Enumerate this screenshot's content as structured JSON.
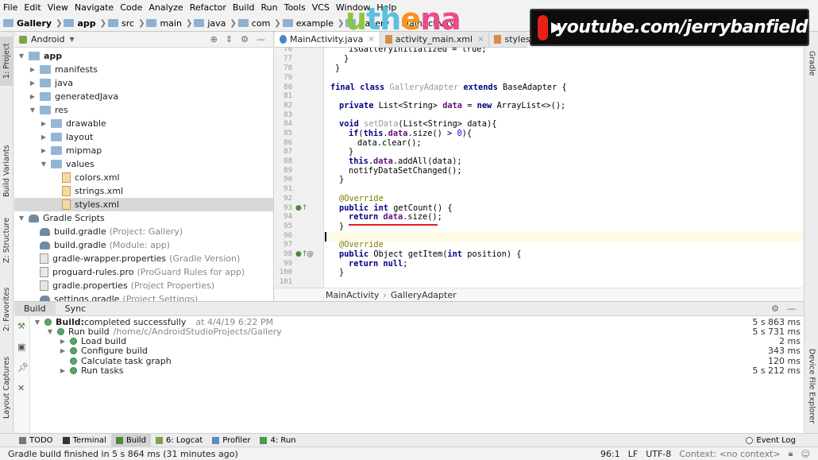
{
  "menu": [
    "File",
    "Edit",
    "View",
    "Navigate",
    "Code",
    "Analyze",
    "Refactor",
    "Build",
    "Run",
    "Tools",
    "VCS",
    "Window",
    "Help"
  ],
  "breadcrumbs": [
    "Gallery",
    "app",
    "src",
    "main",
    "java",
    "com",
    "example",
    "gallery",
    "MainActivity"
  ],
  "overlay": {
    "logo_text_parts": [
      "u",
      "th",
      "e",
      "na"
    ],
    "youtube_text": "youtube.com/jerrybanfield"
  },
  "left_strip": {
    "project": "1: Project",
    "build_variants": "Build Variants",
    "structure": "Z: Structure",
    "favorites": "2: Favorites",
    "layout_captures": "Layout Captures"
  },
  "right_strip": {
    "gradle": "Gradle",
    "device_explorer": "Device File Explorer"
  },
  "project_panel": {
    "selector": "Android",
    "tree": [
      {
        "label": "app",
        "hint": ""
      },
      {
        "label": "manifests",
        "hint": ""
      },
      {
        "label": "java",
        "hint": ""
      },
      {
        "label": "generatedJava",
        "hint": ""
      },
      {
        "label": "res",
        "hint": ""
      },
      {
        "label": "drawable",
        "hint": ""
      },
      {
        "label": "layout",
        "hint": ""
      },
      {
        "label": "mipmap",
        "hint": ""
      },
      {
        "label": "values",
        "hint": ""
      },
      {
        "label": "colors.xml",
        "hint": ""
      },
      {
        "label": "strings.xml",
        "hint": ""
      },
      {
        "label": "styles.xml",
        "hint": ""
      },
      {
        "label": "Gradle Scripts",
        "hint": ""
      },
      {
        "label": "build.gradle",
        "hint": "(Project: Gallery)"
      },
      {
        "label": "build.gradle",
        "hint": "(Module: app)"
      },
      {
        "label": "gradle-wrapper.properties",
        "hint": "(Gradle Version)"
      },
      {
        "label": "proguard-rules.pro",
        "hint": "(ProGuard Rules for app)"
      },
      {
        "label": "gradle.properties",
        "hint": "(Project Properties)"
      },
      {
        "label": "settings.gradle",
        "hint": "(Project Settings)"
      }
    ]
  },
  "editor_tabs": [
    "MainActivity.java",
    "activity_main.xml",
    "styles.xml"
  ],
  "line_numbers": [
    "76",
    "77",
    "78",
    "79",
    "80",
    "81",
    "82",
    "83",
    "84",
    "85",
    "86",
    "87",
    "88",
    "89",
    "90",
    "91",
    "92",
    "93",
    "94",
    "95",
    "96",
    "97",
    "98",
    "99",
    "100",
    "101"
  ],
  "code": {
    "l76": "isGalleryInitialized = true;",
    "l77": "}",
    "l78": "}",
    "l80_kw": "final class ",
    "l80_fn": "GalleryAdapter",
    "l80_kw2": " extends ",
    "l80_rest": "BaseAdapter {",
    "l82_kw": "private ",
    "l82_a": "List<String> ",
    "l82_fld": "data",
    "l82_b": " = ",
    "l82_kw2": "new ",
    "l82_c": "ArrayList<>();",
    "l84_kw": "void ",
    "l84_fn": "setData",
    "l84_rest": "(List<String> data){",
    "l85_kw": "if",
    "l85_a": "(",
    "l85_kw2": "this",
    "l85_b": ".",
    "l85_fld": "data",
    "l85_c": ".size() > ",
    "l85_num": "0",
    "l85_d": "){",
    "l86": "data.clear();",
    "l87": "}",
    "l88_kw": "this",
    "l88_a": ".",
    "l88_fld": "data",
    "l88_b": ".addAll(data);",
    "l89": "notifyDataSetChanged();",
    "l90": "}",
    "l92": "@Override",
    "l93_kw": "public int ",
    "l93_rest": "getCount() {",
    "l94_kw": "return ",
    "l94_fld": "data",
    "l94_rest": ".size();",
    "l95": "}",
    "l97": "@Override",
    "l98_kw": "public ",
    "l98_a": "Object getItem(",
    "l98_kw2": "int ",
    "l98_b": "position) {",
    "l99_kw": "return null",
    "l99_rest": ";",
    "l100": "}"
  },
  "editor_breadcrumbs": [
    "MainActivity",
    "GalleryAdapter"
  ],
  "build_panel": {
    "tabs": [
      "Build",
      "Sync"
    ],
    "rows": [
      {
        "bold": "Build:",
        "text": " completed successfully",
        "detail": "at 4/4/19 6:22 PM",
        "time": "5 s 863 ms"
      },
      {
        "bold": "",
        "text": "Run build",
        "detail": "/home/c/AndroidStudioProjects/Gallery",
        "time": "5 s 731 ms"
      },
      {
        "bold": "",
        "text": "Load build",
        "detail": "",
        "time": "2 ms"
      },
      {
        "bold": "",
        "text": "Configure build",
        "detail": "",
        "time": "343 ms"
      },
      {
        "bold": "",
        "text": "Calculate task graph",
        "detail": "",
        "time": "120 ms"
      },
      {
        "bold": "",
        "text": "Run tasks",
        "detail": "",
        "time": "5 s 212 ms"
      }
    ]
  },
  "bottom_tools": [
    "TODO",
    "Terminal",
    "Build",
    "6: Logcat",
    "Profiler",
    "4: Run"
  ],
  "event_log": "Event Log",
  "status": {
    "message": "Gradle build finished in 5 s 864 ms (31 minutes ago)",
    "position": "96:1",
    "line_sep": "LF",
    "encoding": "UTF-8",
    "context": "Context: <no context>"
  }
}
